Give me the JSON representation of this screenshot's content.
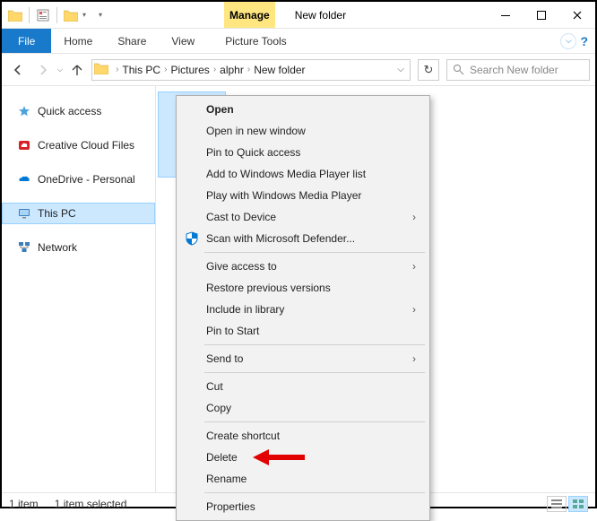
{
  "window": {
    "title": "New folder",
    "manage_tab": "Manage",
    "tool_tab": "Picture Tools"
  },
  "ribbon": {
    "file": "File",
    "home": "Home",
    "share": "Share",
    "view": "View"
  },
  "breadcrumb": [
    "This PC",
    "Pictures",
    "alphr",
    "New folder"
  ],
  "search": {
    "placeholder": "Search New folder"
  },
  "sidebar": {
    "quick_access": "Quick access",
    "creative_cloud": "Creative Cloud Files",
    "onedrive": "OneDrive - Personal",
    "this_pc": "This PC",
    "network": "Network"
  },
  "status": {
    "count": "1 item",
    "selected": "1 item selected"
  },
  "context_menu": {
    "open": "Open",
    "open_new_window": "Open in new window",
    "pin_quick": "Pin to Quick access",
    "add_wmp_list": "Add to Windows Media Player list",
    "play_wmp": "Play with Windows Media Player",
    "cast": "Cast to Device",
    "scan_defender": "Scan with Microsoft Defender...",
    "give_access": "Give access to",
    "restore_prev": "Restore previous versions",
    "include_lib": "Include in library",
    "pin_start": "Pin to Start",
    "send_to": "Send to",
    "cut": "Cut",
    "copy": "Copy",
    "create_shortcut": "Create shortcut",
    "delete": "Delete",
    "rename": "Rename",
    "properties": "Properties"
  }
}
